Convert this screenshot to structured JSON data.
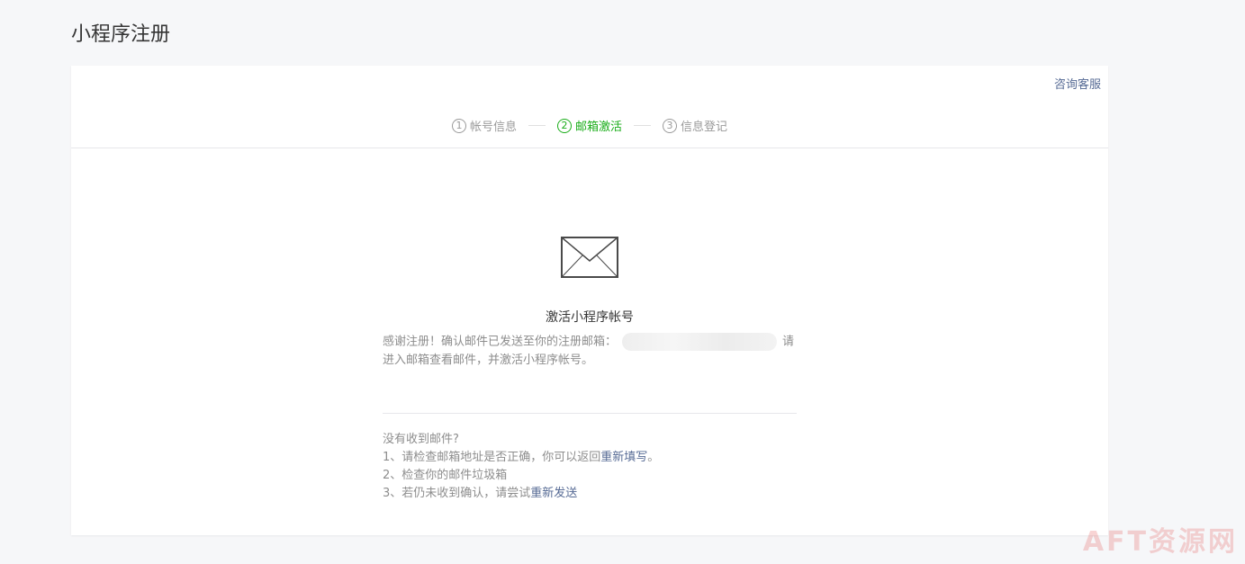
{
  "page": {
    "title": "小程序注册"
  },
  "header": {
    "help_label": "咨询客服"
  },
  "steps": [
    {
      "num": "1",
      "label": "帐号信息"
    },
    {
      "num": "2",
      "label": "邮箱激活"
    },
    {
      "num": "3",
      "label": "信息登记"
    }
  ],
  "main": {
    "title": "激活小程序帐号",
    "desc_prefix": "感谢注册！确认邮件已发送至你的注册邮箱：",
    "desc_suffix": "请进入邮箱查看邮件，并激活小程序帐号。"
  },
  "tips": {
    "heading": "没有收到邮件?",
    "item1_text": "1、请检查邮箱地址是否正确，你可以返回",
    "item1_link": "重新填写",
    "item1_end": "。",
    "item2_text": "2、检查你的邮件垃圾箱",
    "item3_text": "3、若仍未收到确认，请尝试",
    "item3_link": "重新发送"
  },
  "watermark": "AFT资源网",
  "colors": {
    "accent": "#1aad19",
    "link": "#576b95",
    "muted": "#8d8d8d"
  },
  "icons": {
    "mail": "envelope-icon"
  }
}
